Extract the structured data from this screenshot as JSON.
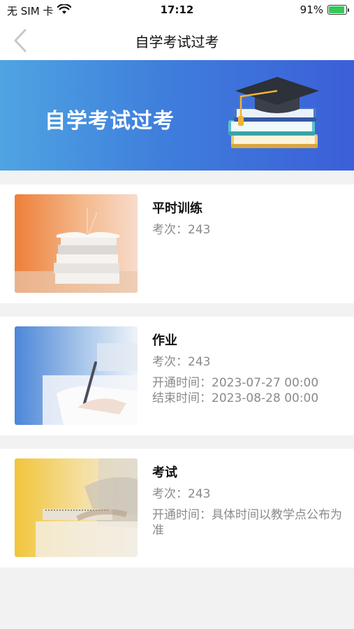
{
  "status_bar": {
    "carrier": "无 SIM 卡",
    "time": "17:12",
    "battery_percent": "91%",
    "battery_level": 0.91
  },
  "nav": {
    "title": "自学考试过考"
  },
  "banner": {
    "title": "自学考试过考"
  },
  "cards": [
    {
      "title": "平时训练",
      "count_label": "考次：",
      "count_value": "243"
    },
    {
      "title": "作业",
      "count_label": "考次：",
      "count_value": "243",
      "open_label": "开通时间：",
      "open_value": "2023-07-27 00:00",
      "end_label": "结束时间：",
      "end_value": "2023-08-28 00:00"
    },
    {
      "title": "考试",
      "count_label": "考次：",
      "count_value": "243",
      "open_label": "开通时间：",
      "open_value": "具体时间以教学点公布为准"
    }
  ]
}
